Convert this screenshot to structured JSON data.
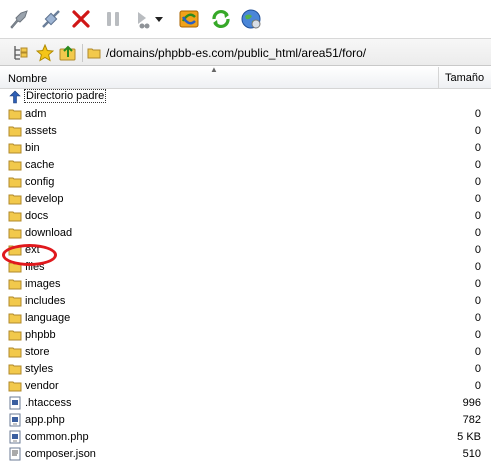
{
  "toolbar": {
    "icons": [
      "connect-icon",
      "disconnect-icon",
      "stop-icon",
      "pause-icon",
      "queue-icon",
      "dropdown-arrow-icon",
      "sync-icon",
      "refresh-icon",
      "globe-icon"
    ]
  },
  "pathbar": {
    "path": "/domains/phpbb-es.com/public_html/area51/foro/"
  },
  "columns": {
    "name": "Nombre",
    "size": "Tamaño"
  },
  "files": [
    {
      "name": "Directorio padre",
      "size": "",
      "icon": "parent-up-icon"
    },
    {
      "name": "adm",
      "size": "0",
      "icon": "folder-icon"
    },
    {
      "name": "assets",
      "size": "0",
      "icon": "folder-icon"
    },
    {
      "name": "bin",
      "size": "0",
      "icon": "folder-icon"
    },
    {
      "name": "cache",
      "size": "0",
      "icon": "folder-icon"
    },
    {
      "name": "config",
      "size": "0",
      "icon": "folder-icon"
    },
    {
      "name": "develop",
      "size": "0",
      "icon": "folder-icon"
    },
    {
      "name": "docs",
      "size": "0",
      "icon": "folder-icon"
    },
    {
      "name": "download",
      "size": "0",
      "icon": "folder-icon"
    },
    {
      "name": "ext",
      "size": "0",
      "icon": "folder-icon"
    },
    {
      "name": "files",
      "size": "0",
      "icon": "folder-icon"
    },
    {
      "name": "images",
      "size": "0",
      "icon": "folder-icon"
    },
    {
      "name": "includes",
      "size": "0",
      "icon": "folder-icon"
    },
    {
      "name": "language",
      "size": "0",
      "icon": "folder-icon"
    },
    {
      "name": "phpbb",
      "size": "0",
      "icon": "folder-icon"
    },
    {
      "name": "store",
      "size": "0",
      "icon": "folder-icon"
    },
    {
      "name": "styles",
      "size": "0",
      "icon": "folder-icon"
    },
    {
      "name": "vendor",
      "size": "0",
      "icon": "folder-icon"
    },
    {
      "name": ".htaccess",
      "size": "996",
      "icon": "file-icon"
    },
    {
      "name": "app.php",
      "size": "782",
      "icon": "php-file-icon"
    },
    {
      "name": "common.php",
      "size": "5 KB",
      "icon": "php-file-icon"
    },
    {
      "name": "composer.json",
      "size": "510",
      "icon": "json-file-icon"
    }
  ],
  "colors": {
    "folder": "#f2c94c",
    "highlight_ring": "#e0191d"
  }
}
